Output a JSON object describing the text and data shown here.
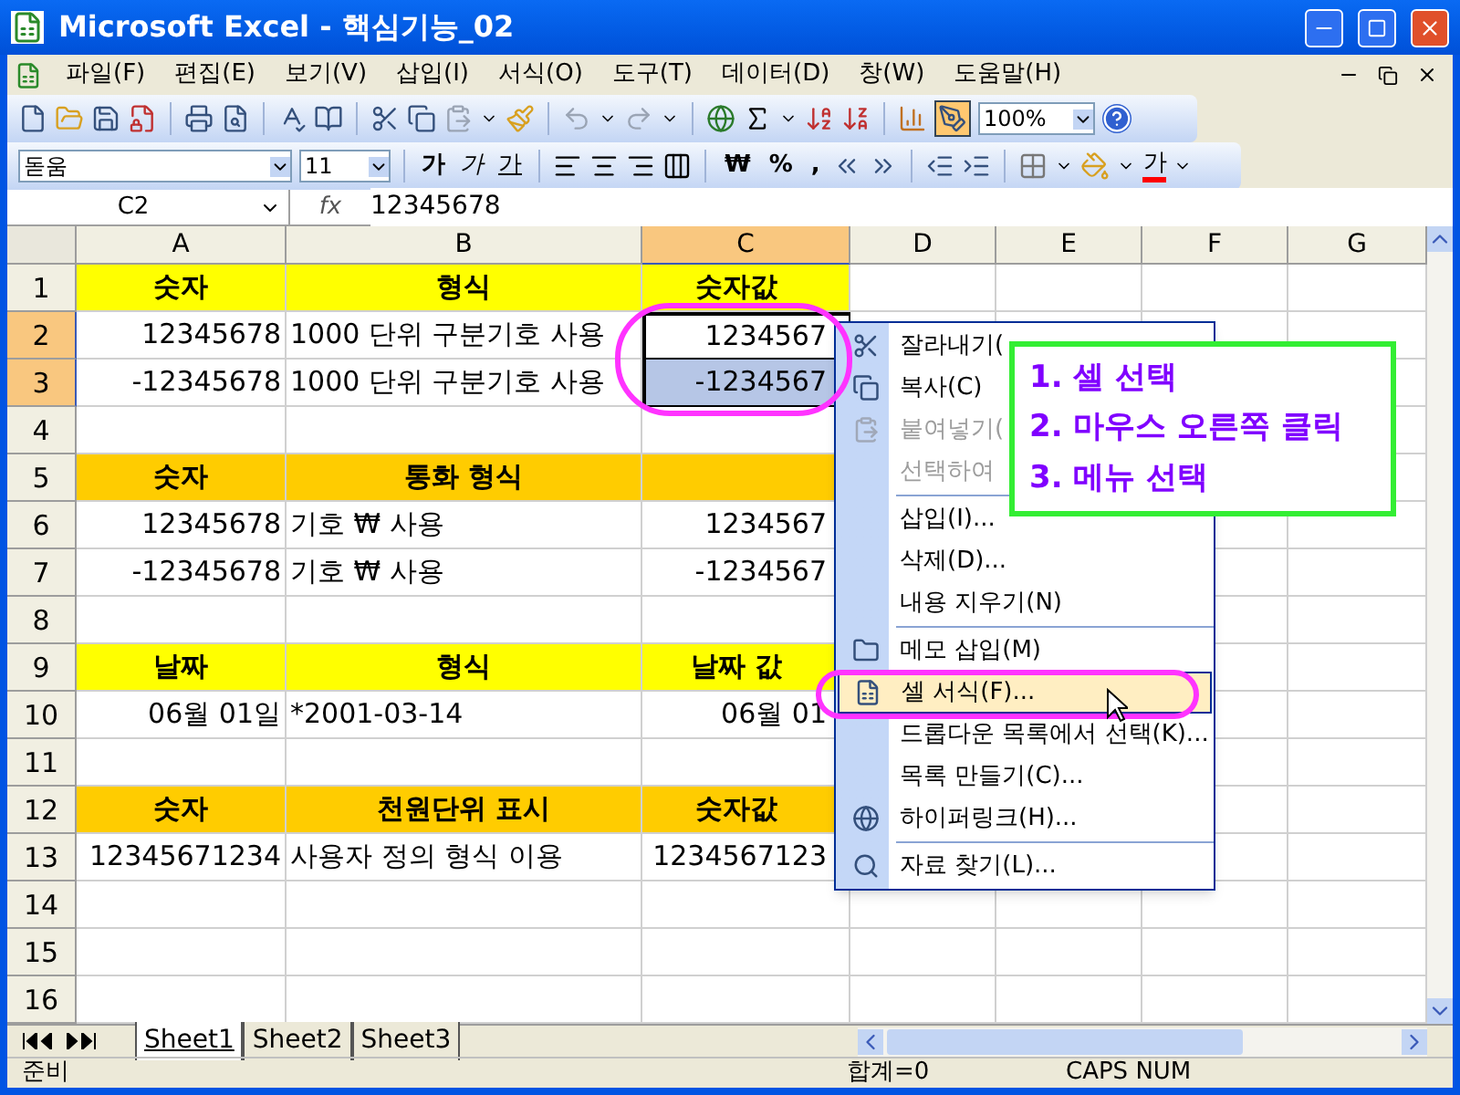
{
  "window": {
    "title": "Microsoft Excel - 핵심기능_02"
  },
  "menu_bar": [
    "파일(F)",
    "편집(E)",
    "보기(V)",
    "삽입(I)",
    "서식(O)",
    "도구(T)",
    "데이터(D)",
    "창(W)",
    "도움말(H)"
  ],
  "standard_toolbar": {
    "zoom": "100%"
  },
  "formatting_toolbar": {
    "font": "돋움",
    "size": "11",
    "buttons": [
      {
        "kind": "bold",
        "label": "가"
      },
      {
        "kind": "italic",
        "label": "가"
      },
      {
        "kind": "underline",
        "label": "가"
      }
    ],
    "number_buttons": [
      "₩",
      "%",
      ","
    ],
    "font_color": "가"
  },
  "formula_bar": {
    "name_box": "C2",
    "fx": "fx",
    "value": "12345678"
  },
  "columns": [
    {
      "label": "A",
      "selected": false
    },
    {
      "label": "B",
      "selected": false
    },
    {
      "label": "C",
      "selected": true
    },
    {
      "label": "D",
      "selected": false
    },
    {
      "label": "E",
      "selected": false
    },
    {
      "label": "F",
      "selected": false
    },
    {
      "label": "G",
      "selected": false
    }
  ],
  "rows": [
    {
      "number": "1",
      "kind": "header_yellow",
      "selected": false,
      "active": false,
      "cells": [
        "숫자",
        "형식",
        "숫자값"
      ]
    },
    {
      "number": "2",
      "kind": "data",
      "selected": true,
      "active": true,
      "cells": [
        "12345678",
        "1000 단위 구분기호 사용",
        "1234567"
      ]
    },
    {
      "number": "3",
      "kind": "data",
      "selected": true,
      "active": false,
      "cells": [
        "-12345678",
        "1000 단위 구분기호 사용",
        "-1234567"
      ]
    },
    {
      "number": "4",
      "kind": "data",
      "selected": false,
      "active": false
    },
    {
      "number": "5",
      "kind": "header_orange",
      "selected": false,
      "active": false,
      "cells": [
        "숫자",
        "통화 형식"
      ]
    },
    {
      "number": "6",
      "kind": "data",
      "selected": false,
      "active": false,
      "cells": [
        "12345678",
        "기호 ₩ 사용",
        "1234567"
      ]
    },
    {
      "number": "7",
      "kind": "data",
      "selected": false,
      "active": false,
      "cells": [
        "-12345678",
        "기호 ₩ 사용",
        "-1234567"
      ]
    },
    {
      "number": "8",
      "kind": "data",
      "selected": false,
      "active": false
    },
    {
      "number": "9",
      "kind": "header_yellow",
      "selected": false,
      "active": false,
      "cells": [
        "날짜",
        "형식",
        "날짜 값"
      ]
    },
    {
      "number": "10",
      "kind": "data",
      "selected": false,
      "active": false,
      "cells": [
        "06월 01일",
        "*2001-03-14",
        "06월 01"
      ]
    },
    {
      "number": "11",
      "kind": "data",
      "selected": false,
      "active": false
    },
    {
      "number": "12",
      "kind": "header_orange",
      "selected": false,
      "active": false,
      "cells": [
        "숫자",
        "천원단위 표시",
        "숫자값"
      ]
    },
    {
      "number": "13",
      "kind": "data",
      "selected": false,
      "active": false,
      "cells": [
        "12345671234",
        "사용자 정의 형식 이용",
        "1234567123"
      ]
    },
    {
      "number": "14",
      "kind": "data",
      "selected": false,
      "active": false
    },
    {
      "number": "15",
      "kind": "data",
      "selected": false,
      "active": false
    },
    {
      "number": "16",
      "kind": "data",
      "selected": false,
      "active": false
    }
  ],
  "context_menu": [
    {
      "label": "잘라내기(",
      "disabled": false,
      "selected": false,
      "separator_above": false
    },
    {
      "label": "복사(C)",
      "disabled": false,
      "selected": false,
      "separator_above": false
    },
    {
      "label": "붙여넣기(",
      "disabled": true,
      "selected": false,
      "separator_above": false
    },
    {
      "label": "선택하여",
      "disabled": true,
      "selected": false,
      "separator_above": false
    },
    {
      "label": "삽입(I)...",
      "disabled": false,
      "selected": false,
      "separator_above": true
    },
    {
      "label": "삭제(D)...",
      "disabled": false,
      "selected": false,
      "separator_above": false
    },
    {
      "label": "내용 지우기(N)",
      "disabled": false,
      "selected": false,
      "separator_above": false
    },
    {
      "label": "메모 삽입(M)",
      "disabled": false,
      "selected": false,
      "separator_above": true
    },
    {
      "label": "셀 서식(F)...",
      "disabled": false,
      "selected": true,
      "separator_above": false
    },
    {
      "label": "드롭다운 목록에서 선택(K)...",
      "disabled": false,
      "selected": false,
      "separator_above": false
    },
    {
      "label": "목록 만들기(C)...",
      "disabled": false,
      "selected": false,
      "separator_above": false
    },
    {
      "label": "하이퍼링크(H)...",
      "disabled": false,
      "selected": false,
      "separator_above": false
    },
    {
      "label": "자료 찾기(L)...",
      "disabled": false,
      "selected": false,
      "separator_above": true
    }
  ],
  "callout": {
    "lines": [
      "1. 셀 선택",
      "2. 마우스 오른쪽 클릭",
      "3. 메뉴 선택"
    ]
  },
  "sheet_tabs": [
    {
      "label": "Sheet1",
      "selected": true
    },
    {
      "label": "Sheet2",
      "selected": false
    },
    {
      "label": "Sheet3",
      "selected": false
    }
  ],
  "status_bar": {
    "mode": "준비",
    "sum": "합계=0",
    "indicators": "CAPS NUM"
  }
}
